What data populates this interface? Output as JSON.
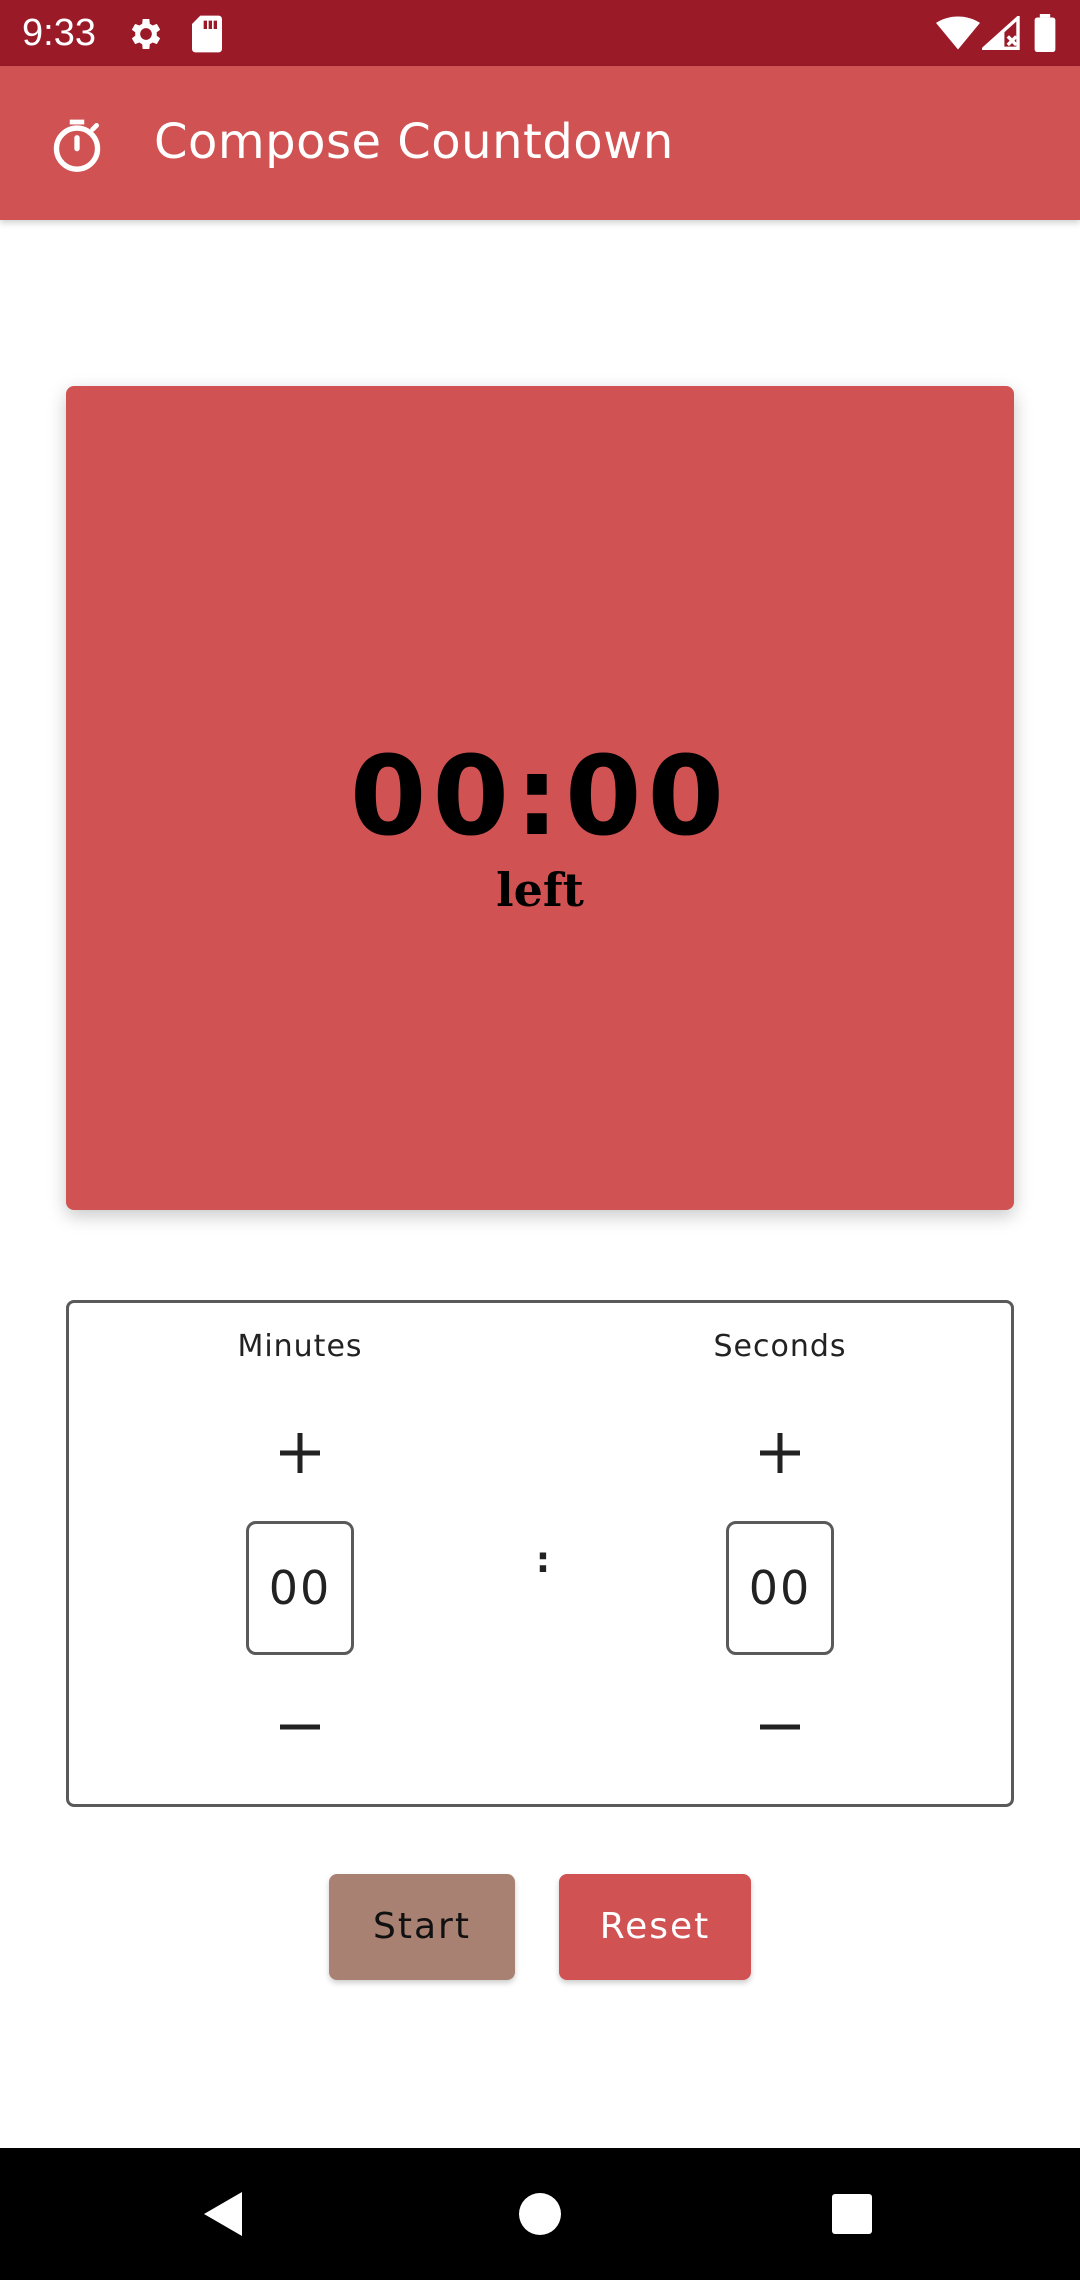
{
  "status_bar": {
    "time": "9:33",
    "icons": [
      "gear-icon",
      "sd-card-icon",
      "wifi-icon",
      "cell-signal-icon",
      "battery-icon"
    ]
  },
  "app_bar": {
    "icon": "timer-icon",
    "title": "Compose Countdown"
  },
  "timer": {
    "display": "00:00",
    "caption": "left"
  },
  "picker": {
    "minutes": {
      "label": "Minutes",
      "value": "00"
    },
    "separator": ":",
    "seconds": {
      "label": "Seconds",
      "value": "00"
    }
  },
  "actions": {
    "start_label": "Start",
    "reset_label": "Reset"
  },
  "colors": {
    "status_bar": "#9a1a28",
    "primary": "#d15252",
    "start_button": "#a88173"
  },
  "nav_bar": {
    "icons": [
      "back-icon",
      "home-icon",
      "recents-icon"
    ]
  }
}
